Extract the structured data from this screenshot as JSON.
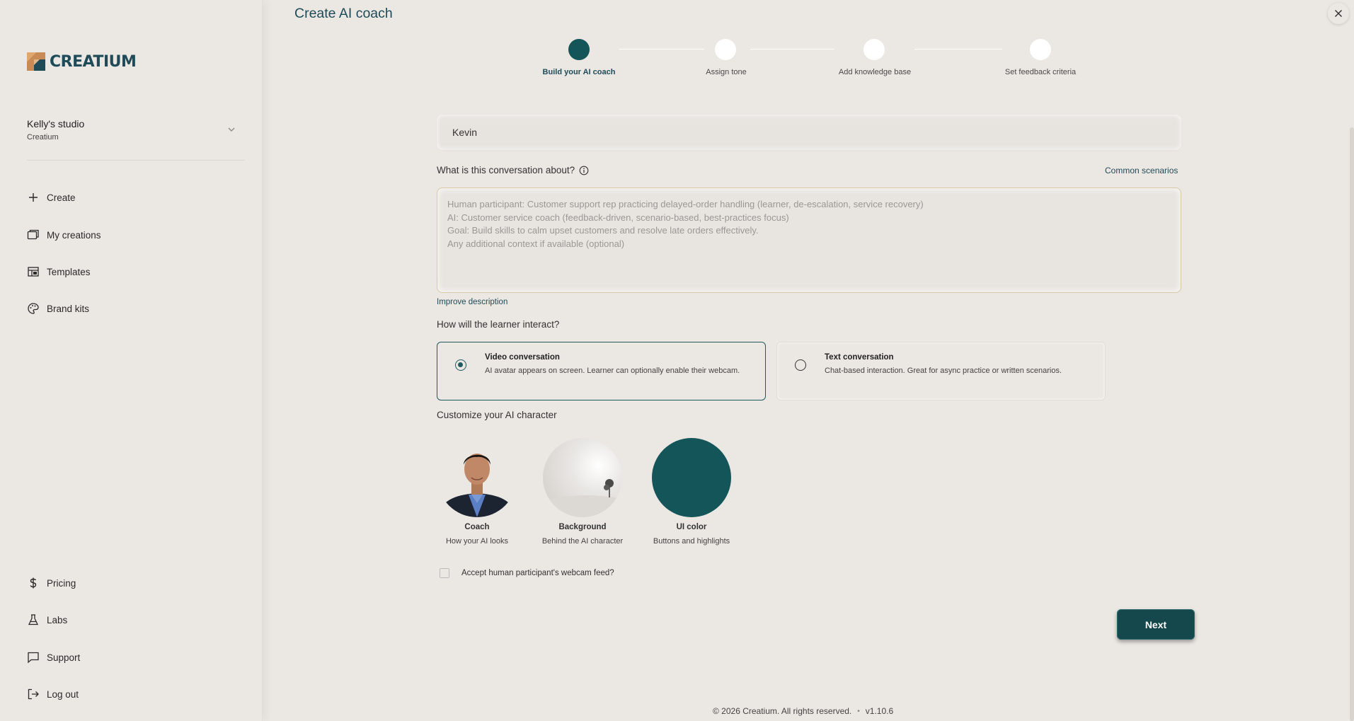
{
  "brand": {
    "name": "CREATIUM",
    "colors": {
      "accent": "#14555a",
      "text_dark": "#1f4b58",
      "bg": "#ebe7e3"
    }
  },
  "studio": {
    "name": "Kelly's studio",
    "org": "Creatium"
  },
  "nav": {
    "top": [
      {
        "label": "Create",
        "icon": "plus-icon"
      },
      {
        "label": "My creations",
        "icon": "folders-icon"
      },
      {
        "label": "Templates",
        "icon": "layout-icon"
      },
      {
        "label": "Brand kits",
        "icon": "palette-icon"
      }
    ],
    "bottom": [
      {
        "label": "Pricing",
        "icon": "dollar-icon"
      },
      {
        "label": "Labs",
        "icon": "flask-icon"
      },
      {
        "label": "Support",
        "icon": "chat-icon"
      },
      {
        "label": "Log out",
        "icon": "logout-icon"
      }
    ]
  },
  "page": {
    "title": "Create AI coach"
  },
  "stepper": {
    "steps": [
      {
        "label": "Build your AI coach",
        "active": true
      },
      {
        "label": "Assign tone",
        "active": false
      },
      {
        "label": "Add knowledge base",
        "active": false
      },
      {
        "label": "Set feedback criteria",
        "active": false
      }
    ]
  },
  "form": {
    "name_value": "Kevin",
    "description_label": "What is this conversation about?",
    "common_scenarios": "Common scenarios",
    "description_placeholder": "Human participant: Customer support rep practicing delayed-order handling (learner, de-escalation, service recovery)\nAI: Customer service coach (feedback-driven, scenario-based, best-practices focus)\nGoal: Build skills to calm upset customers and resolve late orders effectively.\nAny additional context if available (optional)",
    "improve_description": "Improve description",
    "interact_label": "How will the learner interact?",
    "options": [
      {
        "title": "Video conversation",
        "desc": "AI avatar appears on screen. Learner can optionally enable their webcam.",
        "selected": true
      },
      {
        "title": "Text conversation",
        "desc": "Chat-based interaction. Great for async practice or written scenarios.",
        "selected": false
      }
    ],
    "customize_label": "Customize your AI character",
    "characters": [
      {
        "title": "Coach",
        "sub": "How your AI looks"
      },
      {
        "title": "Background",
        "sub": "Behind the AI character"
      },
      {
        "title": "UI color",
        "sub": "Buttons and highlights",
        "color": "#14555a"
      }
    ],
    "webcam_label": "Accept human participant's webcam feed?",
    "webcam_checked": false,
    "next_label": "Next"
  },
  "footer": {
    "copyright": "© 2026 Creatium. All rights reserved.",
    "separator": "•",
    "version": "v1.10.6"
  }
}
